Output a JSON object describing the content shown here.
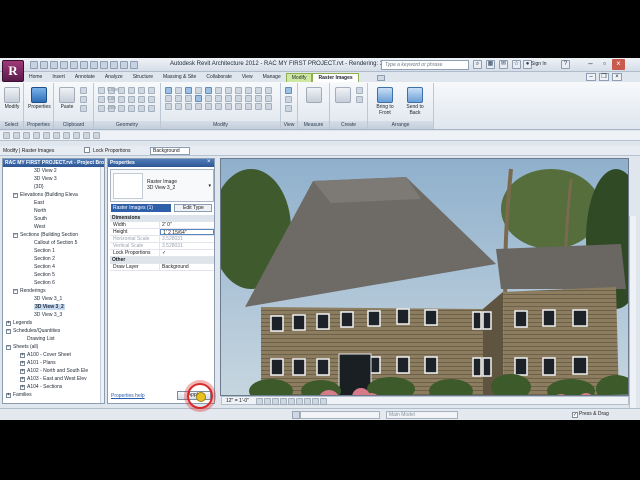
{
  "window": {
    "title": "Autodesk Revit Architecture 2012 -    RAC MY FIRST PROJECT.rvt - Rendering: 3D View 3_2",
    "search_placeholder": "Type a keyword or phrase",
    "sign_in": "Sign In"
  },
  "ribbon_tabs": [
    "Home",
    "Insert",
    "Annotate",
    "Analyze",
    "Structure",
    "Massing & Site",
    "Collaborate",
    "View",
    "Manage",
    "Modify",
    "Raster Images"
  ],
  "ribbon": {
    "modify": "Modify",
    "properties": "Properties",
    "panels": {
      "select": "Select",
      "properties": "Properties",
      "clipboard": "Clipboard",
      "geometry": "Geometry",
      "modify": "Modify",
      "view": "View",
      "measure": "Measure",
      "create": "Create",
      "arrange": "Arrange"
    },
    "paste": "Paste",
    "bring_to_front": "Bring to\nFront",
    "send_to_back": "Send to\nBack",
    "cope": "Cope",
    "cut": "Cut",
    "join": "Join"
  },
  "options_bar": {
    "lock_proportions": "Lock Proportions",
    "alignment": "Background"
  },
  "context_bar": {
    "label": "Modify | Raster Images"
  },
  "browser": {
    "title": "RAC MY FIRST PROJECT.rvt - Project Browser",
    "items": [
      {
        "label": "3D View 2",
        "indent": 4,
        "exp": ""
      },
      {
        "label": "3D View 3",
        "indent": 4,
        "exp": ""
      },
      {
        "label": "{3D}",
        "indent": 4,
        "exp": ""
      },
      {
        "label": "Elevations (Building Eleva",
        "indent": 1,
        "exp": "−"
      },
      {
        "label": "East",
        "indent": 4,
        "exp": ""
      },
      {
        "label": "North",
        "indent": 4,
        "exp": ""
      },
      {
        "label": "South",
        "indent": 4,
        "exp": ""
      },
      {
        "label": "West",
        "indent": 4,
        "exp": ""
      },
      {
        "label": "Sections (Building Section",
        "indent": 1,
        "exp": "−"
      },
      {
        "label": "Callout of Section 5",
        "indent": 4,
        "exp": ""
      },
      {
        "label": "Section 1",
        "indent": 4,
        "exp": ""
      },
      {
        "label": "Section 2",
        "indent": 4,
        "exp": ""
      },
      {
        "label": "Section 4",
        "indent": 4,
        "exp": ""
      },
      {
        "label": "Section 5",
        "indent": 4,
        "exp": ""
      },
      {
        "label": "Section 6",
        "indent": 4,
        "exp": ""
      },
      {
        "label": "Renderings",
        "indent": 1,
        "exp": "−"
      },
      {
        "label": "3D View 3_1",
        "indent": 4,
        "exp": ""
      },
      {
        "label": "3D View 3_2",
        "indent": 4,
        "exp": "",
        "selected": true
      },
      {
        "label": "3D View 3_3",
        "indent": 4,
        "exp": ""
      },
      {
        "label": "Legends",
        "indent": 0,
        "exp": "+"
      },
      {
        "label": "Schedules/Quantities",
        "indent": 0,
        "exp": "−"
      },
      {
        "label": "Drawing List",
        "indent": 3,
        "exp": ""
      },
      {
        "label": "Sheets (all)",
        "indent": 0,
        "exp": "−"
      },
      {
        "label": "A100 - Cover Sheet",
        "indent": 2,
        "exp": "+"
      },
      {
        "label": "A101 - Plans",
        "indent": 2,
        "exp": "+"
      },
      {
        "label": "A102 - North and South Ele",
        "indent": 2,
        "exp": "+"
      },
      {
        "label": "A103 - East and West Elev",
        "indent": 2,
        "exp": "+"
      },
      {
        "label": "A104 - Sections",
        "indent": 2,
        "exp": "+"
      },
      {
        "label": "Families",
        "indent": 0,
        "exp": "+"
      }
    ]
  },
  "properties": {
    "title": "Properties",
    "type_name": "Raster Image",
    "type_sub": "3D View 3_2",
    "instance": "Raster Images (1)",
    "edit_type": "Edit Type",
    "rows": [
      {
        "group": "Dimensions"
      },
      {
        "k": "Width",
        "v": "2' 0\""
      },
      {
        "k": "Height",
        "v": "1' 2 15/64\"",
        "edit": true
      },
      {
        "k": "Horizontal Scale",
        "v": "3.528031",
        "dim": true
      },
      {
        "k": "Vertical Scale",
        "v": "3.528031",
        "dim": true
      },
      {
        "k": "Lock Proportions",
        "v": "✓"
      },
      {
        "group": "Other"
      },
      {
        "k": "Draw Layer",
        "v": "Background"
      }
    ],
    "help": "Properties help",
    "apply": "Apply"
  },
  "view": {
    "scale": "12\" = 1'-0\""
  },
  "status": {
    "message": "",
    "model": "Main Model",
    "press_drag": "Press & Drag"
  },
  "colors": {
    "accent_tab": "#cfe8a0",
    "title_blue": "#2d5694",
    "siding": "#8a7b5e",
    "roof": "#6e6a66"
  }
}
